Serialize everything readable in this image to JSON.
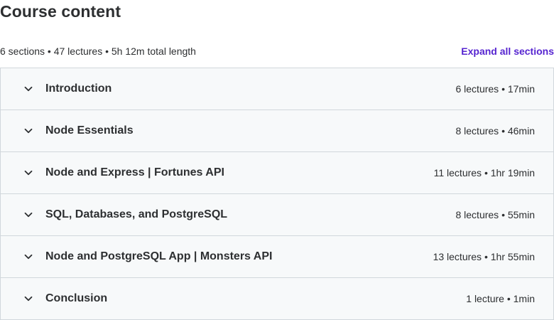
{
  "header": {
    "title": "Course content",
    "summary": "6 sections • 47 lectures • 5h 12m total length",
    "expand_all_label": "Expand all sections"
  },
  "accent_color": "#5624d0",
  "sections": [
    {
      "title": "Introduction",
      "meta": "6 lectures • 17min",
      "icon": "chevron-down-icon"
    },
    {
      "title": "Node Essentials",
      "meta": "8 lectures • 46min",
      "icon": "chevron-down-icon"
    },
    {
      "title": "Node and Express | Fortunes API",
      "meta": "11 lectures • 1hr 19min",
      "icon": "chevron-down-icon"
    },
    {
      "title": "SQL, Databases, and PostgreSQL",
      "meta": "8 lectures • 55min",
      "icon": "chevron-down-icon"
    },
    {
      "title": "Node and PostgreSQL App | Monsters API",
      "meta": "13 lectures • 1hr 55min",
      "icon": "chevron-down-icon"
    },
    {
      "title": "Conclusion",
      "meta": "1 lecture • 1min",
      "icon": "chevron-down-icon"
    }
  ]
}
